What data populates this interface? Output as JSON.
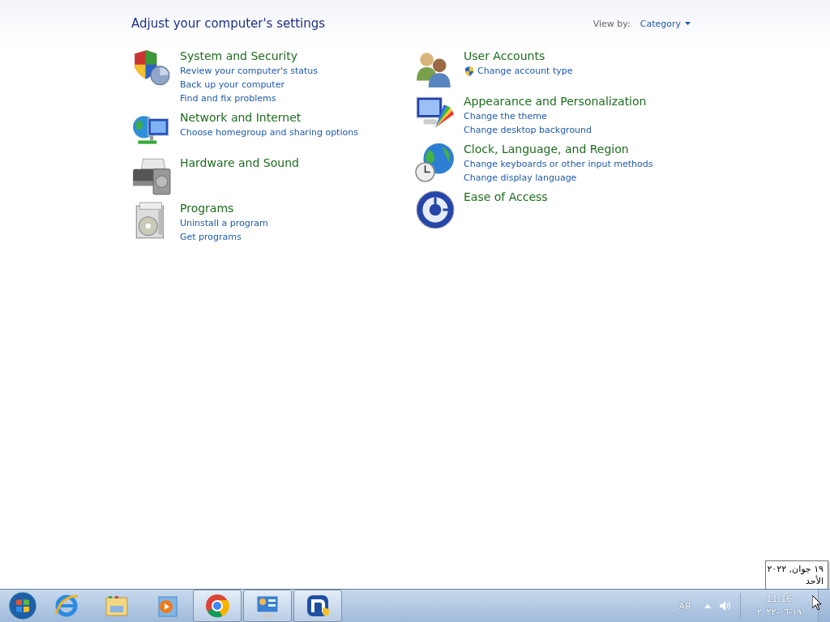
{
  "header": {
    "title": "Adjust your computer's settings",
    "view_by_label": "View by:",
    "view_by_value": "Category"
  },
  "columns": [
    {
      "categories": [
        {
          "kind": "security",
          "title": "System and Security",
          "links": [
            {
              "text": "Review your computer's status",
              "shield": false
            },
            {
              "text": "Back up your computer",
              "shield": false
            },
            {
              "text": "Find and fix problems",
              "shield": false
            }
          ]
        },
        {
          "kind": "network",
          "title": "Network and Internet",
          "links": [
            {
              "text": "Choose homegroup and sharing options",
              "shield": false
            }
          ]
        },
        {
          "kind": "hardware",
          "title": "Hardware and Sound"
        },
        {
          "kind": "programs",
          "title": "Programs",
          "links": [
            {
              "text": "Uninstall a program",
              "shield": false
            },
            {
              "text": "Get programs",
              "shield": false
            }
          ]
        }
      ]
    },
    {
      "categories": [
        {
          "kind": "users",
          "title": "User Accounts",
          "links": [
            {
              "text": "Change account type",
              "shield": true
            }
          ]
        },
        {
          "kind": "appearance",
          "title": "Appearance and Personalization",
          "links": [
            {
              "text": "Change the theme",
              "shield": false
            },
            {
              "text": "Change desktop background",
              "shield": false
            }
          ]
        },
        {
          "kind": "clock",
          "title": "Clock, Language, and Region",
          "links": [
            {
              "text": "Change keyboards or other input methods",
              "shield": false
            },
            {
              "text": "Change display language",
              "shield": false
            }
          ]
        },
        {
          "kind": "access",
          "title": "Ease of Access"
        }
      ]
    }
  ],
  "tooltip": {
    "lines": [
      "١٩ جوان, ٢٠٢٢",
      "الأحد"
    ]
  },
  "taskbar": {
    "apps": [
      {
        "kind": "ie",
        "running": false
      },
      {
        "kind": "explorer",
        "running": false
      },
      {
        "kind": "media",
        "running": false
      },
      {
        "kind": "chrome",
        "running": true
      },
      {
        "kind": "panel",
        "running": true
      },
      {
        "kind": "napp",
        "running": true
      }
    ],
    "language": "AR",
    "time": "11:16",
    "date": "٢٠٢٢-٠٦-١٩"
  }
}
